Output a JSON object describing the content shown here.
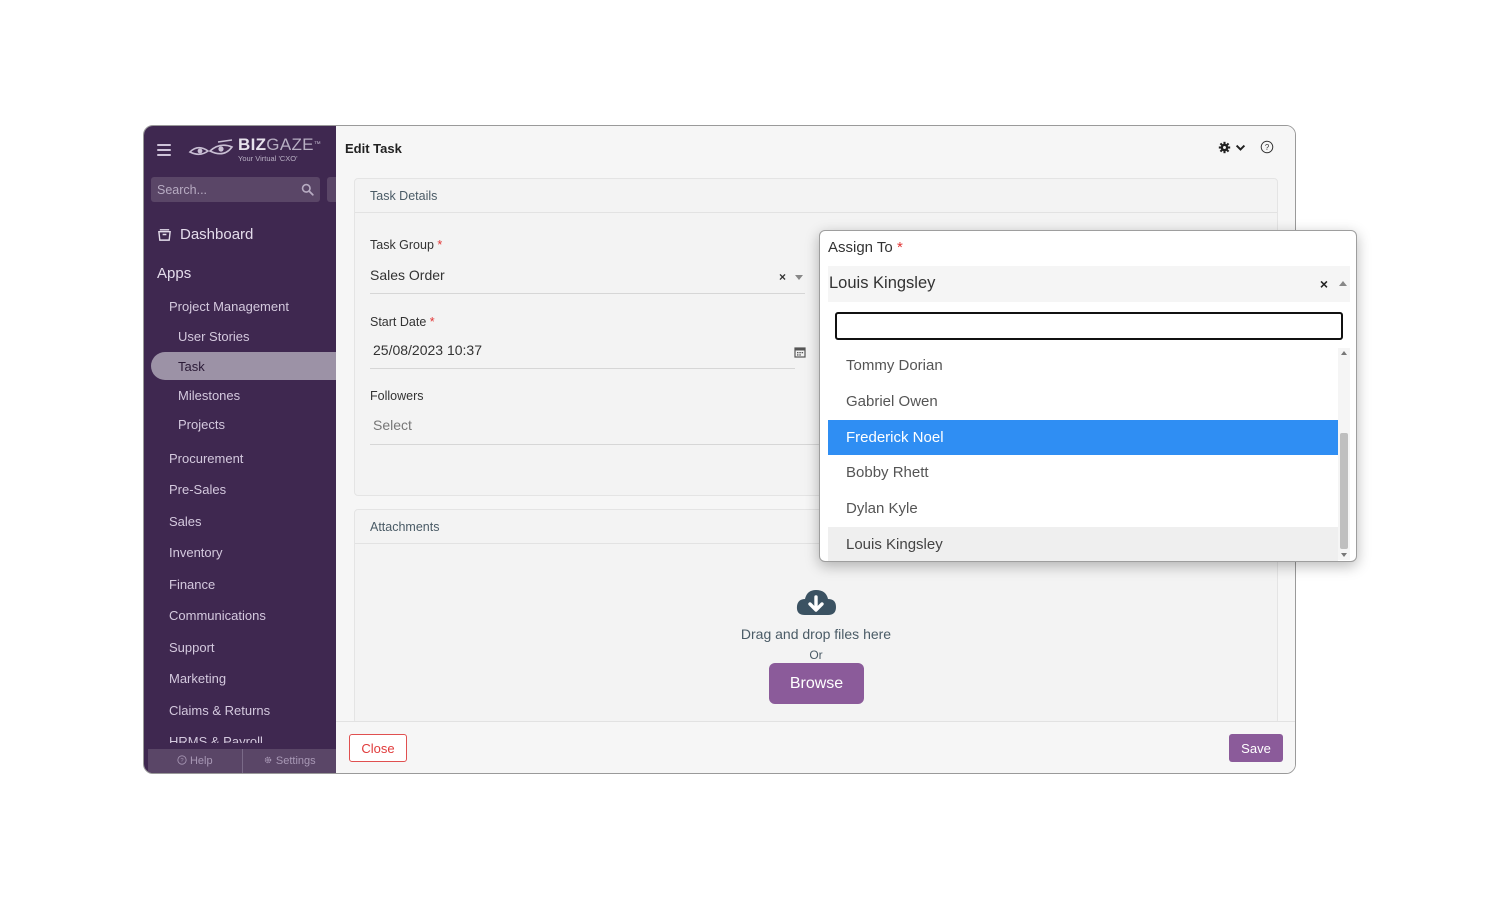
{
  "sidebar": {
    "logo": {
      "name_b": "BIZ",
      "name_g": "GAZE",
      "tm": "™",
      "tagline": "Your Virtual 'CXO'"
    },
    "search_placeholder": "Search...",
    "dashboard": "Dashboard",
    "apps": "Apps",
    "items": [
      {
        "label": "Project Management",
        "level": 1
      },
      {
        "label": "User Stories",
        "level": 2
      },
      {
        "label": "Task",
        "level": 2,
        "active": true
      },
      {
        "label": "Milestones",
        "level": 2
      },
      {
        "label": "Projects",
        "level": 2
      },
      {
        "label": "Procurement",
        "level": 1
      },
      {
        "label": "Pre-Sales",
        "level": 1
      },
      {
        "label": "Sales",
        "level": 1
      },
      {
        "label": "Inventory",
        "level": 1
      },
      {
        "label": "Finance",
        "level": 1
      },
      {
        "label": "Communications",
        "level": 1
      },
      {
        "label": "Support",
        "level": 1
      },
      {
        "label": "Marketing",
        "level": 1
      },
      {
        "label": "Claims & Returns",
        "level": 1
      },
      {
        "label": "HRMS & Payroll",
        "level": 1
      }
    ],
    "footer": {
      "help": "Help",
      "settings": "Settings"
    }
  },
  "header": {
    "title": "Edit Task"
  },
  "task_details": {
    "title": "Task Details",
    "task_group": {
      "label": "Task Group",
      "value": "Sales Order"
    },
    "start_date": {
      "label": "Start Date",
      "value": "25/08/2023 10:37"
    },
    "followers": {
      "label": "Followers",
      "placeholder": "Select"
    }
  },
  "attachments": {
    "title": "Attachments",
    "drag_text": "Drag and drop files here",
    "or_text": "Or",
    "browse": "Browse"
  },
  "footer": {
    "close": "Close",
    "save": "Save"
  },
  "assign_to": {
    "label": "Assign To",
    "value": "Louis Kingsley",
    "search_value": "",
    "options": [
      "Tommy Dorian",
      "Gabriel Owen",
      "Frederick Noel",
      "Bobby Rhett",
      "Dylan Kyle",
      "Louis Kingsley"
    ],
    "highlighted": "Frederick Noel",
    "selected": "Louis Kingsley"
  },
  "required_mark": "*",
  "colors": {
    "brand": "#8b5b9a",
    "sidebar": "#3f2850",
    "highlight": "#2f8ef3",
    "required": "#e23535"
  }
}
